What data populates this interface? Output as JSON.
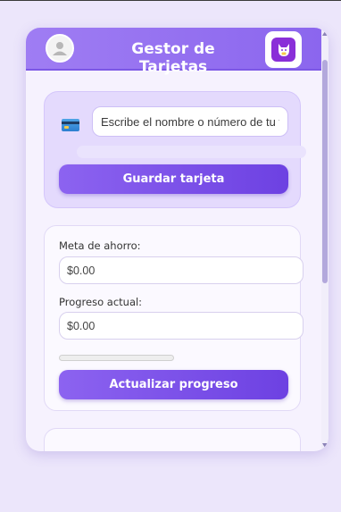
{
  "header": {
    "title": "Gestor de Tarjetas",
    "avatar_icon": "user-avatar-icon",
    "app_icon": "fox-purse-icon"
  },
  "card_form": {
    "icon": "credit-card-icon",
    "input_value": "",
    "input_placeholder": "Escribe el nombre o número de tu tarjeta",
    "save_label": "Guardar tarjeta"
  },
  "savings": {
    "goal_label": "Meta de ahorro:",
    "goal_value": "",
    "goal_placeholder": "$0.00",
    "progress_label": "Progreso actual:",
    "progress_value": "",
    "progress_placeholder": "$0.00",
    "progress_fraction": 0,
    "update_label": "Actualizar progreso"
  },
  "colors": {
    "accent": "#8b66ee",
    "button": "#7a4fe8",
    "background": "#ece6fb"
  }
}
